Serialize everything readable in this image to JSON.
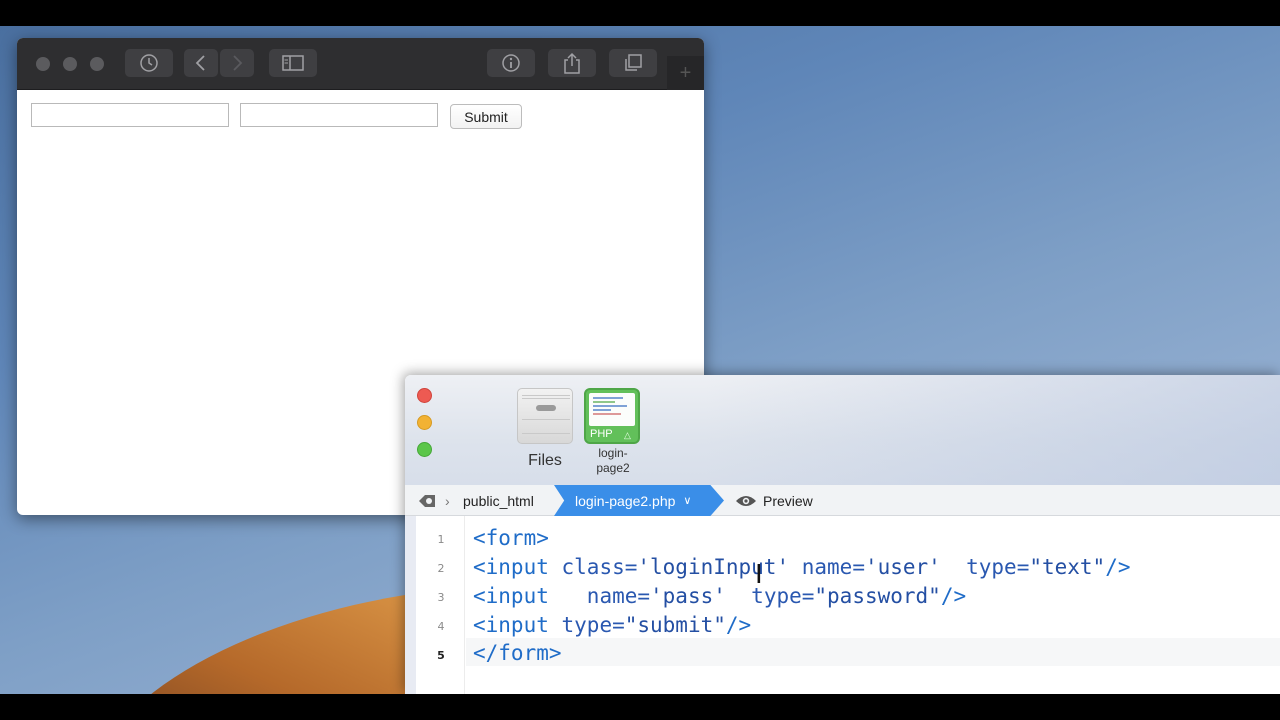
{
  "browser": {
    "toolbar": {
      "history_icon": "clock-icon",
      "back_icon": "chevron-left-icon",
      "forward_icon": "chevron-right-icon",
      "sidebar_icon": "sidebar-icon",
      "info_icon": "info-icon",
      "share_icon": "share-icon",
      "tabs_icon": "tabs-icon",
      "new_tab_label": "+"
    },
    "page": {
      "user_value": "",
      "pass_value": "",
      "submit_label": "Submit"
    }
  },
  "editor": {
    "files": [
      {
        "label": "Files",
        "icon": "files-icon"
      },
      {
        "label": "login-page2",
        "badge": "PHP",
        "icon": "php-file-icon"
      }
    ],
    "breadcrumb": {
      "folder": "public_html",
      "file": "login-page2.php",
      "preview": "Preview"
    },
    "line_numbers": [
      "1",
      "2",
      "3",
      "4",
      "5"
    ],
    "current_line": "5",
    "colors": {
      "tag": "#1f6cc8",
      "attr": "#2a58b0",
      "active_crumb": "#3a8ee8"
    }
  }
}
